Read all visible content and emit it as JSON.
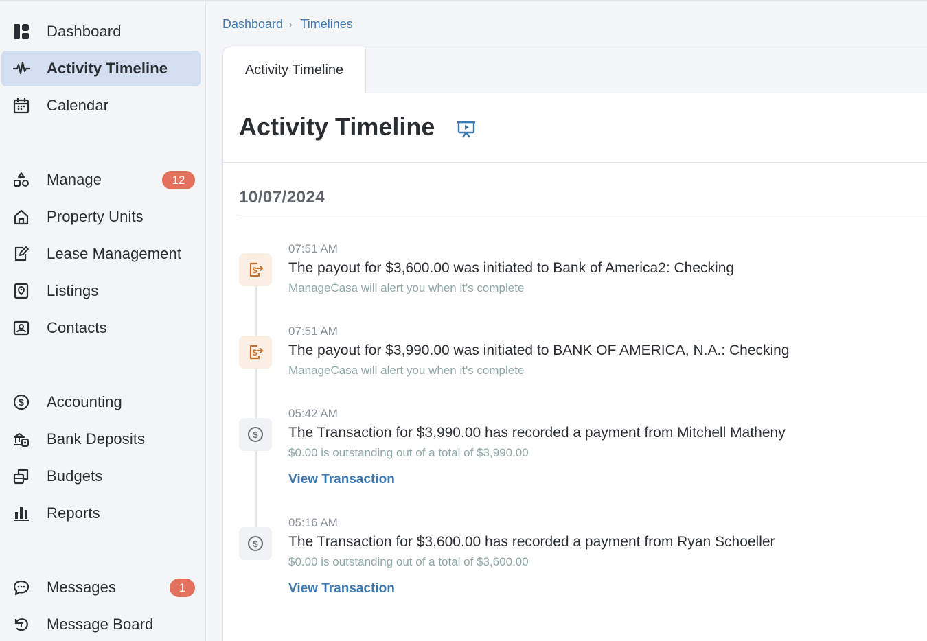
{
  "sidebar": {
    "items": [
      {
        "label": "Dashboard",
        "icon": "dashboard-icon"
      },
      {
        "label": "Activity Timeline",
        "icon": "activity-icon",
        "active": true
      },
      {
        "label": "Calendar",
        "icon": "calendar-icon"
      },
      {
        "label": "Manage",
        "icon": "shapes-icon",
        "badge": "12"
      },
      {
        "label": "Property Units",
        "icon": "home-icon"
      },
      {
        "label": "Lease Management",
        "icon": "edit-document-icon"
      },
      {
        "label": "Listings",
        "icon": "map-pin-icon"
      },
      {
        "label": "Contacts",
        "icon": "contact-card-icon"
      },
      {
        "label": "Accounting",
        "icon": "dollar-circle-icon"
      },
      {
        "label": "Bank Deposits",
        "icon": "bank-deposit-icon"
      },
      {
        "label": "Budgets",
        "icon": "budget-icon"
      },
      {
        "label": "Reports",
        "icon": "bar-chart-icon"
      },
      {
        "label": "Messages",
        "icon": "chat-bubble-icon",
        "badge": "1"
      },
      {
        "label": "Message Board",
        "icon": "message-board-icon"
      }
    ]
  },
  "breadcrumb": {
    "items": [
      "Dashboard",
      "Timelines"
    ],
    "separator": "›"
  },
  "tabs": {
    "active": "Activity Timeline"
  },
  "page": {
    "title": "Activity Timeline",
    "present_icon": "presentation-icon"
  },
  "timeline": {
    "date": "10/07/2024",
    "events": [
      {
        "type": "payout",
        "icon": "payout-icon",
        "time": "07:51 AM",
        "message": "The payout for $3,600.00 was initiated to Bank of America2: Checking",
        "sub": "ManageCasa will alert you when it's complete"
      },
      {
        "type": "payout",
        "icon": "payout-icon",
        "time": "07:51 AM",
        "message": "The payout for $3,990.00 was initiated to BANK OF AMERICA, N.A.: Checking",
        "sub": "ManageCasa will alert you when it's complete"
      },
      {
        "type": "transaction",
        "icon": "dollar-circle-icon",
        "time": "05:42 AM",
        "message": "The Transaction for $3,990.00 has recorded a payment from Mitchell Matheny",
        "sub": "$0.00 is outstanding out of a total of $3,990.00",
        "link": "View Transaction"
      },
      {
        "type": "transaction",
        "icon": "dollar-circle-icon",
        "time": "05:16 AM",
        "message": "The Transaction for $3,600.00 has recorded a payment from Ryan Schoeller",
        "sub": "$0.00 is outstanding out of a total of $3,600.00",
        "link": "View Transaction"
      }
    ]
  },
  "colors": {
    "accent": "#3d77b0",
    "badge": "#e2725e",
    "active_bg": "#d3dff0",
    "payout_icon": "#c2702a"
  }
}
